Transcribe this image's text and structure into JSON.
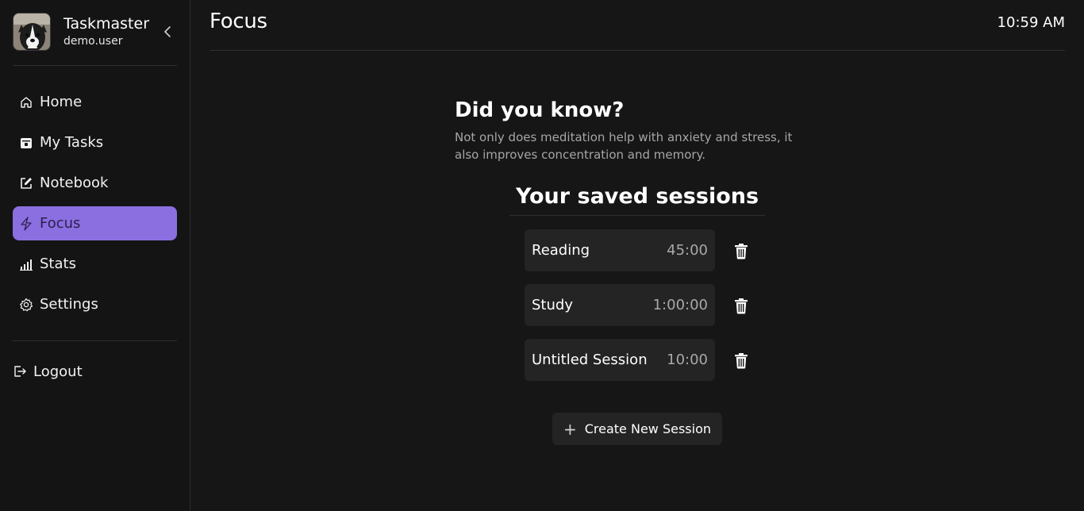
{
  "sidebar": {
    "app_name": "Taskmaster",
    "username": "demo.user",
    "nav": [
      {
        "label": "Home",
        "icon": "home-icon"
      },
      {
        "label": "My Tasks",
        "icon": "calendar-icon"
      },
      {
        "label": "Notebook",
        "icon": "edit-icon"
      },
      {
        "label": "Focus",
        "icon": "bolt-icon",
        "active": true
      },
      {
        "label": "Stats",
        "icon": "bar-chart-icon"
      },
      {
        "label": "Settings",
        "icon": "gear-icon"
      }
    ],
    "logout_label": "Logout"
  },
  "header": {
    "title": "Focus",
    "time": "10:59 AM"
  },
  "tip": {
    "title": "Did you know?",
    "body": "Not only does meditation help with anxiety and stress, it also improves concentration and memory."
  },
  "sessions": {
    "title": "Your saved sessions",
    "items": [
      {
        "name": "Reading",
        "duration": "45:00"
      },
      {
        "name": "Study",
        "duration": "1:00:00"
      },
      {
        "name": "Untitled Session",
        "duration": "10:00"
      }
    ],
    "create_label": "Create New Session"
  },
  "colors": {
    "accent": "#8b6fe0",
    "background": "#161616",
    "card": "#242424"
  }
}
